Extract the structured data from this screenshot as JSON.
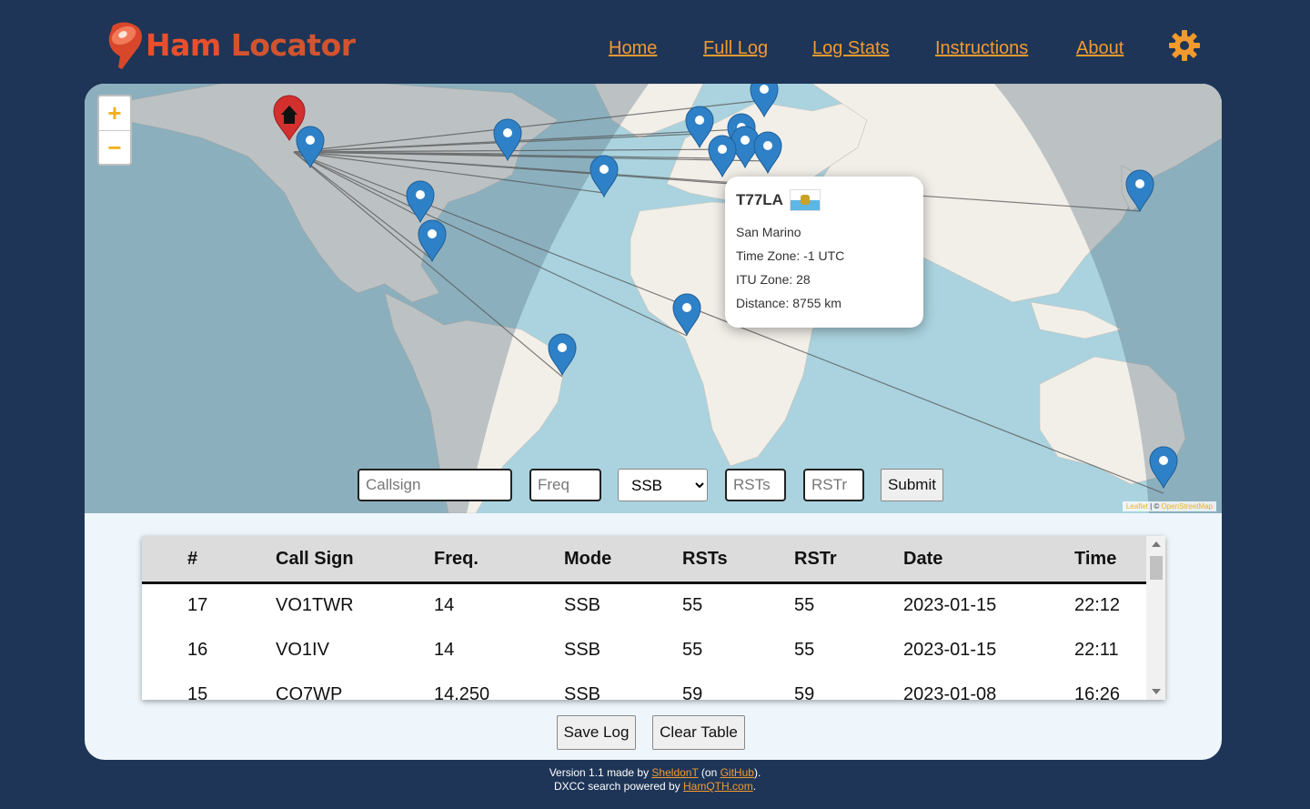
{
  "app": {
    "name_part1": "Ham",
    "name_part2": "Locator"
  },
  "nav": {
    "items": [
      {
        "label": "Home"
      },
      {
        "label": "Full Log"
      },
      {
        "label": "Log Stats"
      },
      {
        "label": "Instructions"
      },
      {
        "label": "About"
      }
    ],
    "settings_icon": "gear-icon"
  },
  "map": {
    "zoom_in": "+",
    "zoom_out": "−",
    "attribution_leaflet": "Leaflet",
    "attribution_sep": " | © ",
    "attribution_osm": "OpenStreetMap",
    "home_icon": "house-icon",
    "popup": {
      "callsign": "T77LA",
      "flag_icon": "san-marino-flag-icon",
      "country": "San Marino",
      "time_zone": "Time Zone: -1 UTC",
      "itu_zone": "ITU Zone: 28",
      "distance": "Distance: 8755 km"
    }
  },
  "form": {
    "callsign_placeholder": "Callsign",
    "freq_placeholder": "Freq",
    "mode_selected": "SSB",
    "rsts_placeholder": "RSTs",
    "rstr_placeholder": "RSTr",
    "submit_label": "Submit"
  },
  "table": {
    "headers": [
      "#",
      "Call Sign",
      "Freq.",
      "Mode",
      "RSTs",
      "RSTr",
      "Date",
      "Time"
    ],
    "rows": [
      [
        "17",
        "VO1TWR",
        "14",
        "SSB",
        "55",
        "55",
        "2023-01-15",
        "22:12"
      ],
      [
        "16",
        "VO1IV",
        "14",
        "SSB",
        "55",
        "55",
        "2023-01-15",
        "22:11"
      ],
      [
        "15",
        "CO7WP",
        "14.250",
        "SSB",
        "59",
        "59",
        "2023-01-08",
        "16:26"
      ]
    ]
  },
  "actions": {
    "save_label": "Save Log",
    "clear_label": "Clear Table"
  },
  "footer": {
    "line1_prefix": "Version 1.1 made by ",
    "author": "SheldonT",
    "line1_mid": " (on ",
    "github": "GitHub",
    "line1_suffix": ").",
    "line2_prefix": "DXCC search powered by ",
    "hamqth": "HamQTH.com",
    "line2_suffix": "."
  },
  "colors": {
    "background": "#1e3557",
    "accent": "#f29a2e",
    "logo_red": "#e94f2c",
    "marker_blue": "#2f81c7",
    "home_marker_red": "#d32f2f"
  }
}
